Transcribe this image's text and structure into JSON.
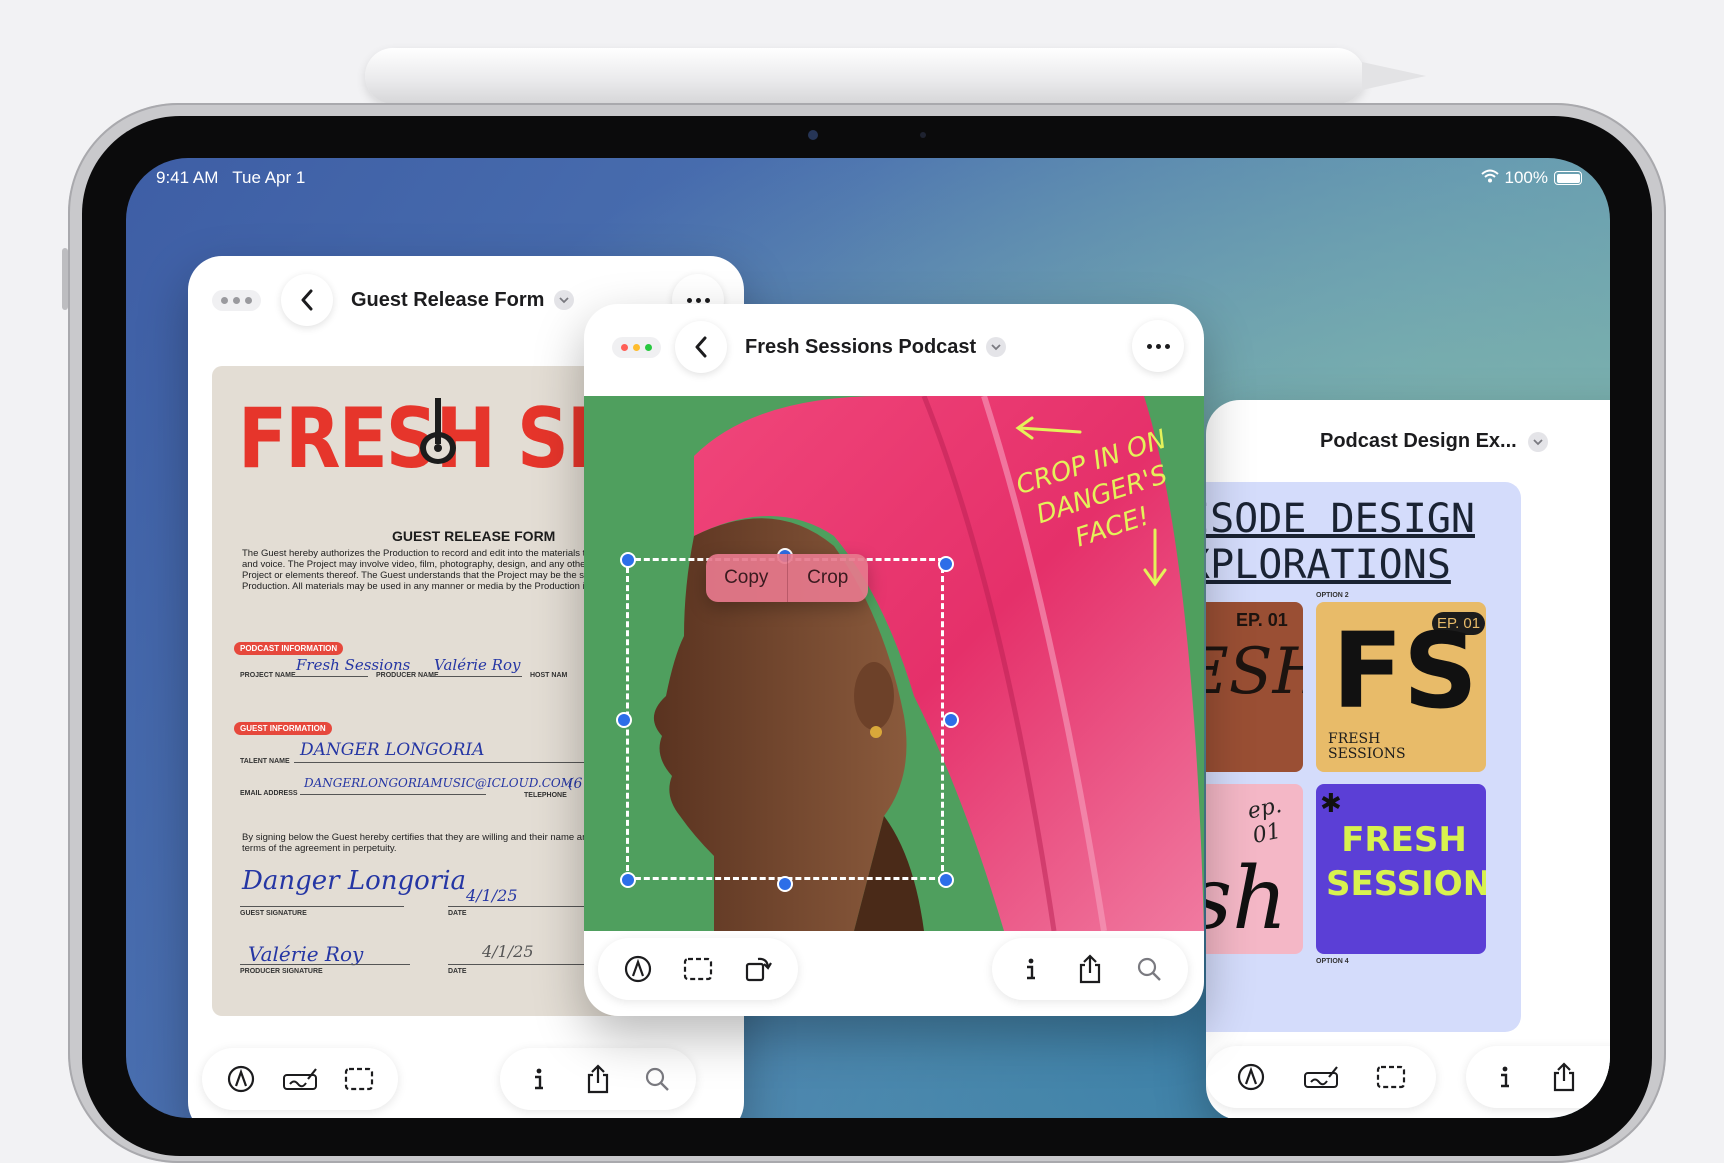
{
  "status_bar": {
    "time": "9:41 AM",
    "date": "Tue Apr 1",
    "battery": "100%",
    "battery_level": 1.0
  },
  "windows": {
    "guest_release": {
      "title": "Guest Release Form",
      "document": {
        "banner": "FRESH SESS",
        "heading": "GUEST RELEASE FORM",
        "intro": "The Guest hereby authorizes the Production to record and edit into the materials their name, likeness, image, and voice. The Project may involve video, film, photography, design, and any other physical or digital medium. Project or elements thereof. The Guest understands that the Project may be the sole discretion of the Production. All materials may be used in any manner or media by the Production internationally.",
        "podcast_tag": "PODCAST INFORMATION",
        "project_name_label": "PROJECT NAME",
        "project_name_value": "Fresh Sessions",
        "producer_name_label": "PRODUCER NAME",
        "producer_name_value": "Valérie Roy",
        "host_name_label": "HOST NAM",
        "guest_tag": "GUEST INFORMATION",
        "talent_name_label": "TALENT NAME",
        "talent_name_value": "DANGER LONGORIA",
        "email_label": "EMAIL ADDRESS",
        "email_value": "DANGERLONGORIAMUSIC@ICLOUD.COM",
        "telephone_label": "TELEPHONE",
        "telephone_value": "(6",
        "consent": "By signing below the Guest hereby certifies that they are willing and their name and likeness and have read the terms of the agreement in perpetuity.",
        "guest_signature_value": "Danger Longoria",
        "guest_signature_label": "GUEST SIGNATURE",
        "guest_date_label": "DATE",
        "guest_date_value": "4/1/25",
        "producer_signature_value": "Valérie Roy",
        "producer_signature_label": "PRODUCER SIGNATURE",
        "producer_date_label": "DATE",
        "producer_date_value": "4/1/25"
      },
      "toolbar_left": [
        "markup-icon",
        "signature-icon",
        "selection-icon"
      ],
      "toolbar_right": [
        "info-icon",
        "share-icon",
        "search-icon"
      ]
    },
    "fresh_sessions": {
      "title": "Fresh Sessions Podcast",
      "context_menu": {
        "copy": "Copy",
        "crop": "Crop"
      },
      "annotation": [
        "CROP IN ON",
        "DANGER'S",
        "FACE!"
      ],
      "toolbar_left": [
        "markup-icon",
        "selection-icon",
        "rotate-icon"
      ],
      "toolbar_right": [
        "info-icon",
        "share-icon",
        "search-icon"
      ]
    },
    "podcast_design": {
      "title": "Podcast Design Ex...",
      "board_title_line1": "ISODE DESIGN",
      "board_title_line2": "XPLORATIONS",
      "option_2": "OPTION 2",
      "option_4": "OPTION 4",
      "card1_ep": "EP. 01",
      "card1_text": "ESH",
      "card2_ep": "EP. 01",
      "card2_logo": "FS",
      "card2_name": "FRESH SESSIONS",
      "card3_ep": "ep. 01",
      "card3_text": "sh",
      "card4_text": "FRESH SESSIONS",
      "toolbar_left": [
        "markup-icon",
        "signature-icon",
        "selection-icon"
      ],
      "toolbar_right": [
        "info-icon",
        "share-icon",
        "search-icon"
      ]
    }
  },
  "colors": {
    "banner_red": "#e6352b",
    "handle_blue": "#2d6ee8",
    "annotation_yellow": "#e4f25a",
    "photo_green": "#4f9f5e",
    "hair_pink": "#e8336b"
  }
}
